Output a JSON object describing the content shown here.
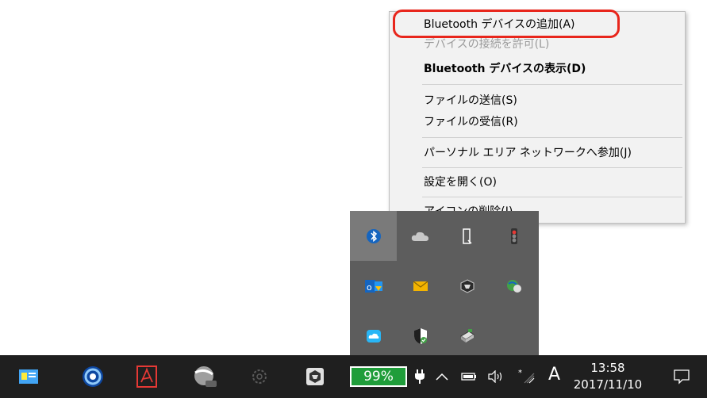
{
  "context_menu": {
    "items": [
      {
        "label": "Bluetooth デバイスの追加(A)"
      },
      {
        "label": "デバイスの接続を許可(L)"
      },
      {
        "label": "Bluetooth デバイスの表示(D)"
      },
      {
        "label": "ファイルの送信(S)"
      },
      {
        "label": "ファイルの受信(R)"
      },
      {
        "label": "パーソナル エリア ネットワークへ参加(J)"
      },
      {
        "label": "設定を開く(O)"
      },
      {
        "label": "アイコンの削除(I)"
      }
    ],
    "highlight_color": "#e8261c"
  },
  "tray_overflow": {
    "icons": [
      "bluetooth-icon",
      "onedrive-icon",
      "usb-drive-icon",
      "traffic-light-icon",
      "outlook-icon",
      "mail-icon",
      "app-cube-icon",
      "chat-globe-icon",
      "cloud-app-icon",
      "security-shield-icon",
      "printer-icon"
    ]
  },
  "taskbar": {
    "battery_percent": "99%",
    "ime_mode": "A",
    "clock": {
      "time": "13:58",
      "date": "2017/11/10"
    },
    "battery_badge_color": "#1f9d3a"
  }
}
